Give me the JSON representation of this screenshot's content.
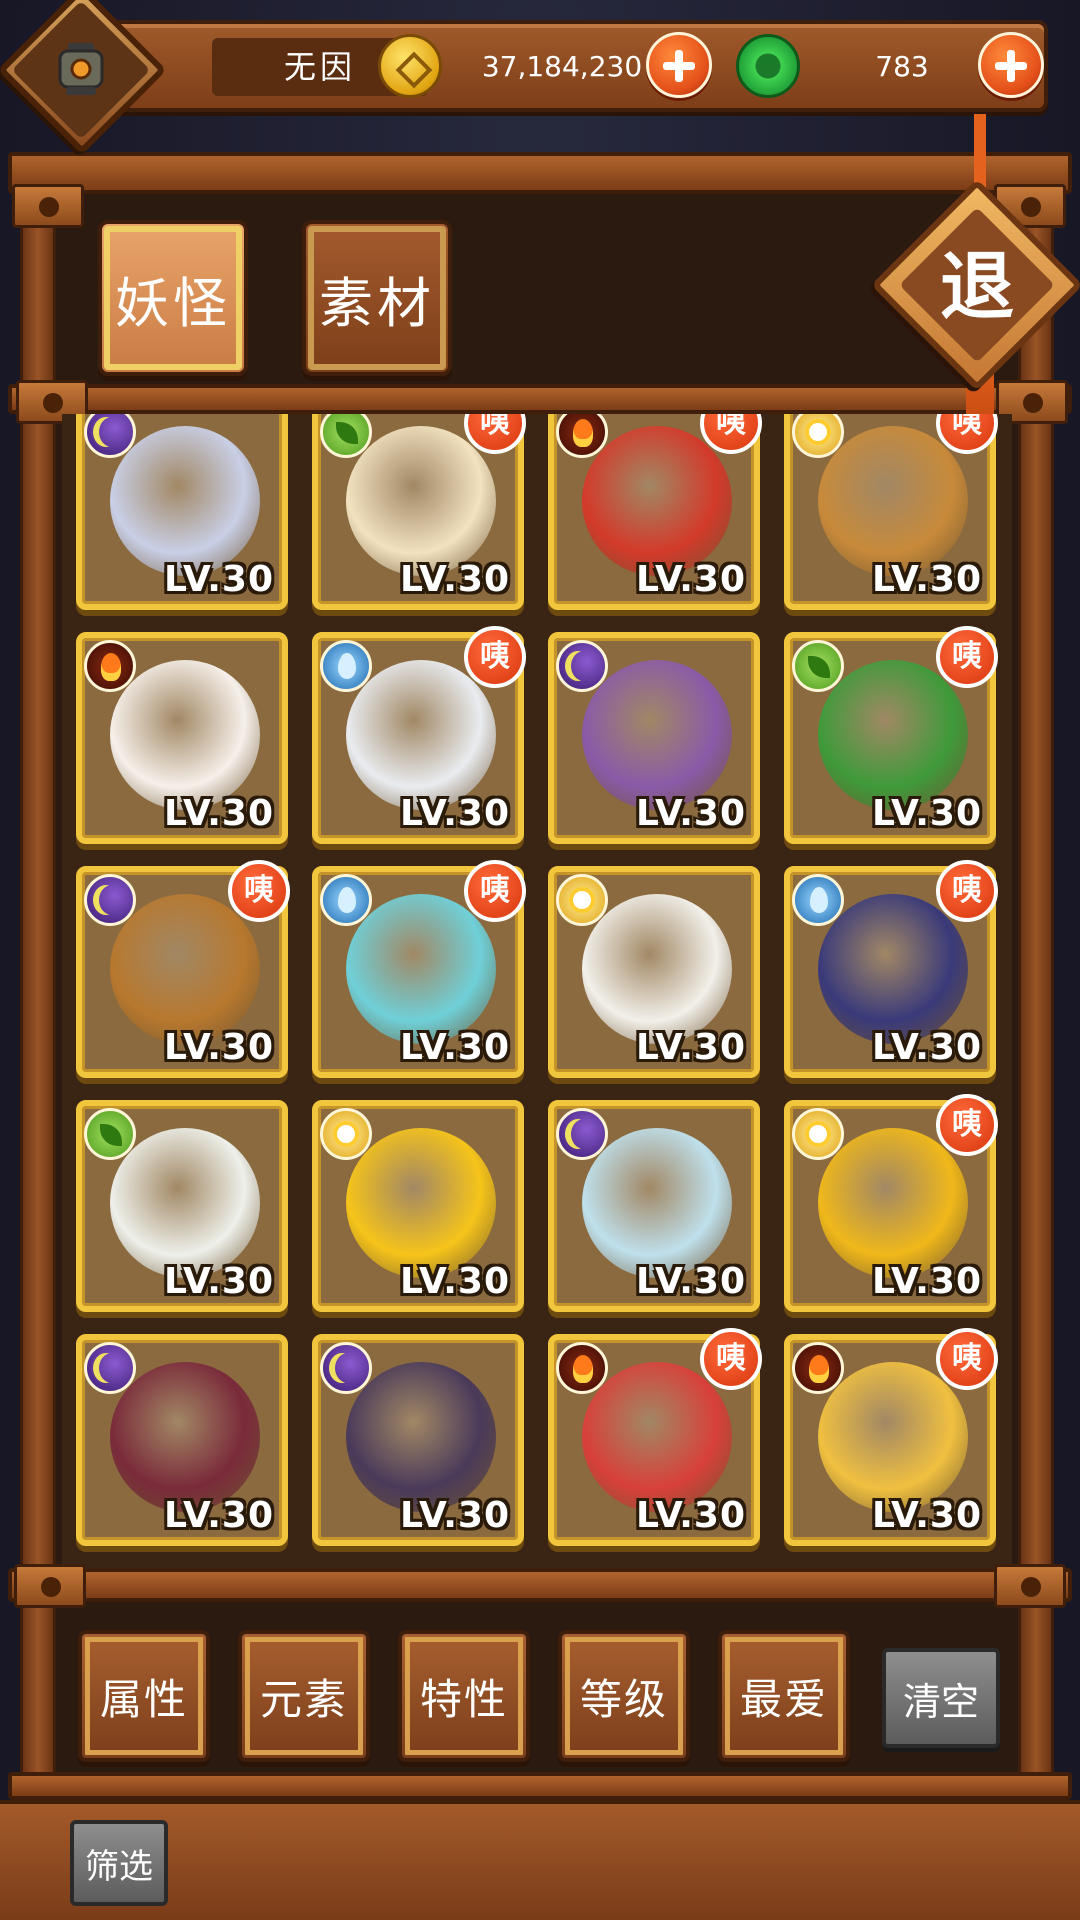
{
  "player": {
    "name": "无因",
    "gold": "37,184,230",
    "jade": "783"
  },
  "tabs": [
    {
      "label": "妖怪",
      "active": true
    },
    {
      "label": "素材",
      "active": false
    }
  ],
  "exit_label": "退",
  "badge_text": "咦",
  "monsters": [
    {
      "element": "moon",
      "level": "LV.30",
      "new": false,
      "art_color": "#c9cfe6"
    },
    {
      "element": "leaf",
      "level": "LV.30",
      "new": true,
      "art_color": "#f2e2c0"
    },
    {
      "element": "fire",
      "level": "LV.30",
      "new": true,
      "art_color": "#d33a2a"
    },
    {
      "element": "sun",
      "level": "LV.30",
      "new": true,
      "art_color": "#c88a3a"
    },
    {
      "element": "fire",
      "level": "LV.30",
      "new": false,
      "art_color": "#f6f0ea"
    },
    {
      "element": "water",
      "level": "LV.30",
      "new": true,
      "art_color": "#e9ecf0"
    },
    {
      "element": "moon",
      "level": "LV.30",
      "new": false,
      "art_color": "#8a5aa8"
    },
    {
      "element": "leaf",
      "level": "LV.30",
      "new": true,
      "art_color": "#3f9a3a"
    },
    {
      "element": "moon",
      "level": "LV.30",
      "new": true,
      "art_color": "#b8782e"
    },
    {
      "element": "water",
      "level": "LV.30",
      "new": true,
      "art_color": "#6fd0d8"
    },
    {
      "element": "sun",
      "level": "LV.30",
      "new": false,
      "art_color": "#f2f0ea"
    },
    {
      "element": "water",
      "level": "LV.30",
      "new": true,
      "art_color": "#3a3a7a"
    },
    {
      "element": "leaf",
      "level": "LV.30",
      "new": false,
      "art_color": "#eef0ea"
    },
    {
      "element": "sun",
      "level": "LV.30",
      "new": false,
      "art_color": "#f6c41a"
    },
    {
      "element": "moon",
      "level": "LV.30",
      "new": false,
      "art_color": "#bfe0ec"
    },
    {
      "element": "sun",
      "level": "LV.30",
      "new": true,
      "art_color": "#f0b81a"
    },
    {
      "element": "moon",
      "level": "LV.30",
      "new": false,
      "art_color": "#7a2a3a"
    },
    {
      "element": "moon",
      "level": "LV.30",
      "new": false,
      "art_color": "#4a3a5a"
    },
    {
      "element": "fire",
      "level": "LV.30",
      "new": true,
      "art_color": "#d8403a"
    },
    {
      "element": "fire",
      "level": "LV.30",
      "new": true,
      "art_color": "#f0c040"
    }
  ],
  "filters": {
    "attribute": "属性",
    "element": "元素",
    "trait": "特性",
    "level": "等级",
    "favorite": "最爱",
    "clear": "清空",
    "screen": "筛选"
  },
  "colors": {
    "wood": "#8a4a1e",
    "card_border": "#f1c53c",
    "accent_orange": "#e4501a",
    "jade": "#21a23a"
  }
}
